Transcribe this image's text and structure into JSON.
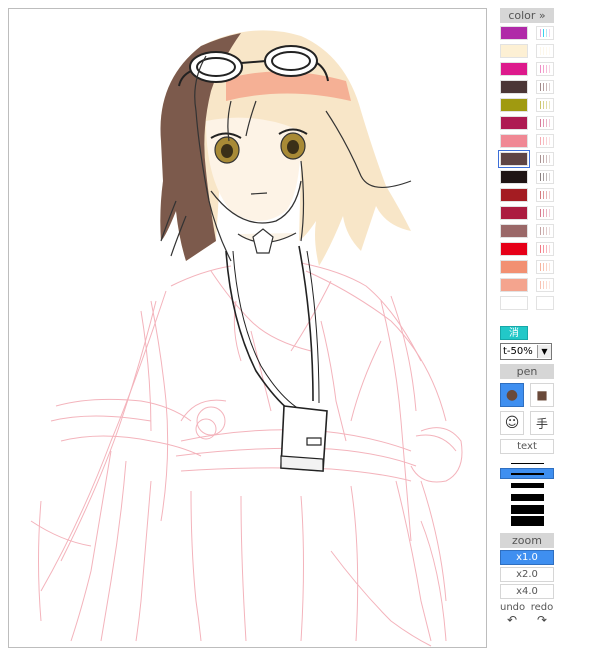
{
  "palette": {
    "header": "color »",
    "swatches": [
      {
        "base": "#b02aa8",
        "tints": [
          "#e5a5e0",
          "#3ad0f0",
          "#b4e4f6",
          "#f2d6ee"
        ]
      },
      {
        "base": "#fdf0d4",
        "tints": [
          "#fdf7ea",
          "#fdf7ea",
          "#fff9ee",
          "#fffaf2"
        ]
      },
      {
        "base": "#dd1a8c",
        "tints": [
          "#ee8cc6",
          "#f3a3cd",
          "#f6bbd8",
          "#f9d2e4"
        ]
      },
      {
        "base": "#4b3636",
        "tints": [
          "#a08888",
          "#b49c9c",
          "#c8b6b6",
          "#dcd0d0"
        ]
      },
      {
        "base": "#a09a10",
        "tints": [
          "#cbc66a",
          "#d6d28a",
          "#e0dda6",
          "#eae8c2"
        ]
      },
      {
        "base": "#ae1a52",
        "tints": [
          "#d8789a",
          "#e296b0",
          "#eab2c6",
          "#f2cedc"
        ]
      },
      {
        "base": "#f08894",
        "tints": [
          "#f6aab2",
          "#f8bcc2",
          "#fad0d4",
          "#fce2e4"
        ]
      },
      {
        "base": "#5e4444",
        "tints": [
          "#a89090",
          "#bca6a6",
          "#d0bebe",
          "#e2d6d6"
        ]
      },
      {
        "base": "#1e1414",
        "tints": [
          "#8a8080",
          "#a49c9c",
          "#beb8b8",
          "#d8d4d4"
        ]
      },
      {
        "base": "#a41c22",
        "tints": [
          "#d4787c",
          "#de9698",
          "#e8b4b6",
          "#f2d2d2"
        ]
      },
      {
        "base": "#ac1c40",
        "tints": [
          "#d8788e",
          "#e296a8",
          "#eab4c2",
          "#f2d2dc"
        ]
      },
      {
        "base": "#9a6868",
        "tints": [
          "#c4a2a2",
          "#d2b6b6",
          "#e0caca",
          "#ecdede"
        ]
      },
      {
        "base": "#e60018",
        "tints": [
          "#f27884",
          "#f596a0",
          "#f8b4ba",
          "#fbd2d6"
        ]
      },
      {
        "base": "#f29072",
        "tints": [
          "#f6b29c",
          "#f8c2b0",
          "#fad2c4",
          "#fce2d8"
        ]
      },
      {
        "base": "#f4a48e",
        "tints": [
          "#f8c0b0",
          "#facec0",
          "#fcdcd2",
          "#fde8e2"
        ]
      },
      {
        "base": "#ffffff",
        "tints": [
          "#ffffff",
          "#ffffff",
          "#ffffff",
          "#ffffff"
        ]
      }
    ],
    "selected_index": 7
  },
  "eraser_label": "消",
  "transparency_value": "t-50%",
  "pen": {
    "header": "pen",
    "dot_label": "●",
    "square_label": "■",
    "smiley_label": "☺",
    "hand_label": "手",
    "text_label": "text"
  },
  "zoom": {
    "header": "zoom",
    "levels": [
      "x1.0",
      "x2.0",
      "x4.0"
    ],
    "selected_index": 0
  },
  "history": {
    "undo_label": "undo",
    "redo_label": "redo"
  }
}
